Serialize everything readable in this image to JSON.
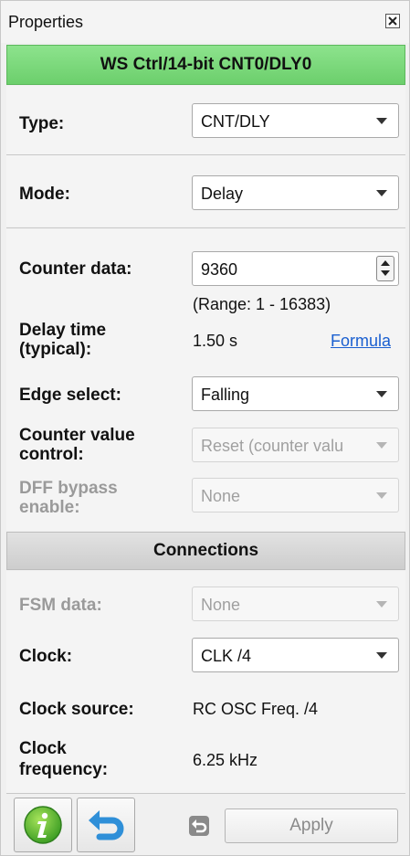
{
  "window": {
    "title": "Properties"
  },
  "header": {
    "title": "WS Ctrl/14-bit CNT0/DLY0"
  },
  "type": {
    "label": "Type:",
    "value": "CNT/DLY"
  },
  "mode": {
    "label": "Mode:",
    "value": "Delay"
  },
  "counter": {
    "label": "Counter data:",
    "value": "9360",
    "range": "(Range:  1 - 16383)"
  },
  "delay": {
    "label_line1": "Delay time",
    "label_line2": "(typical):",
    "value": "1.50 s",
    "link": "Formula"
  },
  "edge": {
    "label": "Edge select:",
    "value": "Falling"
  },
  "counter_value_control": {
    "label_line1": "Counter value",
    "label_line2": "control:",
    "value": "Reset (counter valu"
  },
  "dff_bypass": {
    "label_line1": "DFF bypass",
    "label_line2": "enable:",
    "value": "None"
  },
  "connections": {
    "title": "Connections"
  },
  "fsm": {
    "label": "FSM data:",
    "value": "None"
  },
  "clock": {
    "label": "Clock:",
    "value": "CLK /4"
  },
  "clock_source": {
    "label": "Clock source:",
    "value": "RC OSC Freq. /4"
  },
  "clock_frequency": {
    "label_line1": "Clock",
    "label_line2": "frequency:",
    "value": "6.25 kHz"
  },
  "footer": {
    "apply_label": "Apply"
  },
  "colors": {
    "header_green": "#7ddc7d",
    "info_green": "#4cae2f",
    "undo_blue": "#2f8fd8",
    "link_blue": "#1a5fd0"
  }
}
